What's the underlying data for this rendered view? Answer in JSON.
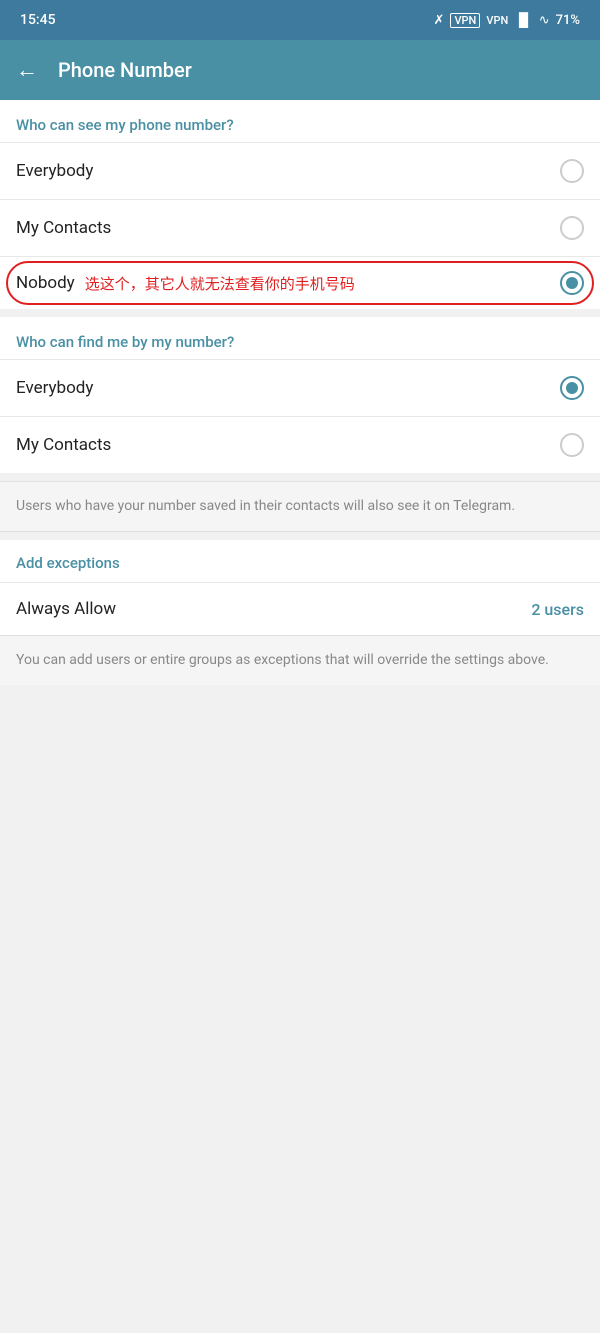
{
  "statusBar": {
    "time": "15:45",
    "bluetooth": "⚡",
    "vpn": "VPN",
    "signal": "HD",
    "wifi": "wifi",
    "battery": "71"
  },
  "header": {
    "backLabel": "←",
    "title": "Phone Number"
  },
  "section1": {
    "label": "Who can see my phone number?",
    "options": [
      {
        "id": "everybody1",
        "label": "Everybody",
        "selected": false
      },
      {
        "id": "mycontacts1",
        "label": "My Contacts",
        "selected": false
      },
      {
        "id": "nobody",
        "label": "Nobody",
        "annotation": "选这个，其它人就无法查看你的手机号码",
        "selected": true
      }
    ]
  },
  "section2": {
    "label": "Who can find me by my number?",
    "options": [
      {
        "id": "everybody2",
        "label": "Everybody",
        "selected": true
      },
      {
        "id": "mycontacts2",
        "label": "My Contacts",
        "selected": false
      }
    ],
    "infoText": "Users who have your number saved in their contacts will also see it on Telegram."
  },
  "exceptions": {
    "label": "Add exceptions",
    "alwaysAllow": {
      "label": "Always Allow",
      "count": "2 users"
    },
    "infoText": "You can add users or entire groups as exceptions that will override the settings above."
  },
  "colors": {
    "accent": "#4a90a4",
    "red": "#e02020",
    "selectedRadio": "#4a90a4",
    "unselectedRadio": "#ccc"
  }
}
